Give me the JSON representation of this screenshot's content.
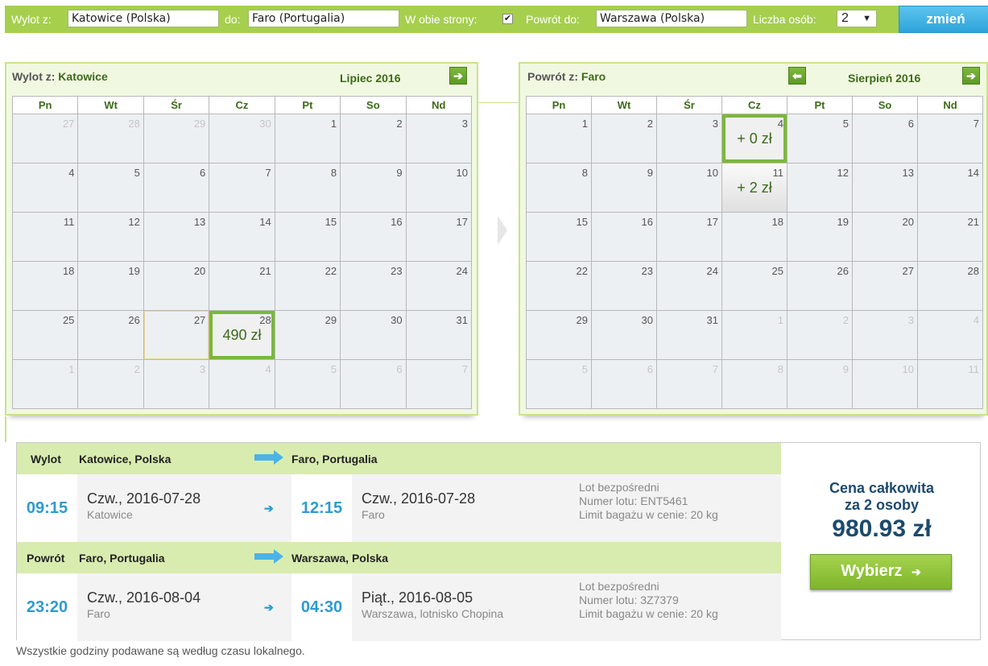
{
  "search": {
    "from_label": "Wylot z:",
    "from_value": "Katowice (Polska)",
    "to_label": "do:",
    "to_value": "Faro (Portugalia)",
    "roundtrip_label": "W obie strony:",
    "roundtrip_checked": "✔",
    "return_label": "Powrót do:",
    "return_value": "Warszawa (Polska)",
    "persons_label": "Liczba osób:",
    "persons_value": "2",
    "change_button": "zmień"
  },
  "outbound_calendar": {
    "header_prefix": "Wylot z:",
    "header_city": "Katowice",
    "month": "Lipiec 2016",
    "next_icon": "arrow-right-icon",
    "weekdays": [
      "Pn",
      "Wt",
      "Śr",
      "Cz",
      "Pt",
      "So",
      "Nd"
    ],
    "days": [
      {
        "n": "27",
        "other": true
      },
      {
        "n": "28",
        "other": true
      },
      {
        "n": "29",
        "other": true
      },
      {
        "n": "30",
        "other": true
      },
      {
        "n": "1"
      },
      {
        "n": "2"
      },
      {
        "n": "3"
      },
      {
        "n": "4"
      },
      {
        "n": "5"
      },
      {
        "n": "6"
      },
      {
        "n": "7"
      },
      {
        "n": "8"
      },
      {
        "n": "9"
      },
      {
        "n": "10"
      },
      {
        "n": "11"
      },
      {
        "n": "12"
      },
      {
        "n": "13"
      },
      {
        "n": "14"
      },
      {
        "n": "15"
      },
      {
        "n": "16"
      },
      {
        "n": "17"
      },
      {
        "n": "18"
      },
      {
        "n": "19"
      },
      {
        "n": "20"
      },
      {
        "n": "21"
      },
      {
        "n": "22"
      },
      {
        "n": "23"
      },
      {
        "n": "24"
      },
      {
        "n": "25"
      },
      {
        "n": "26"
      },
      {
        "n": "27",
        "dashed": true
      },
      {
        "n": "28",
        "price": "490 zł",
        "selected": true
      },
      {
        "n": "29"
      },
      {
        "n": "30"
      },
      {
        "n": "31"
      },
      {
        "n": "1",
        "other": true
      },
      {
        "n": "2",
        "other": true
      },
      {
        "n": "3",
        "other": true
      },
      {
        "n": "4",
        "other": true
      },
      {
        "n": "5",
        "other": true
      },
      {
        "n": "6",
        "other": true
      },
      {
        "n": "7",
        "other": true
      }
    ]
  },
  "return_calendar": {
    "header_prefix": "Powrót z:",
    "header_city": "Faro",
    "month": "Sierpień 2016",
    "prev_icon": "arrow-left-icon",
    "next_icon": "arrow-right-icon",
    "weekdays": [
      "Pn",
      "Wt",
      "Śr",
      "Cz",
      "Pt",
      "So",
      "Nd"
    ],
    "days": [
      {
        "n": "1"
      },
      {
        "n": "2"
      },
      {
        "n": "3"
      },
      {
        "n": "4",
        "price": "+ 0 zł",
        "selected": true
      },
      {
        "n": "5"
      },
      {
        "n": "6"
      },
      {
        "n": "7"
      },
      {
        "n": "8"
      },
      {
        "n": "9"
      },
      {
        "n": "10"
      },
      {
        "n": "11",
        "price": "+ 2 zł",
        "highlight": true
      },
      {
        "n": "12"
      },
      {
        "n": "13"
      },
      {
        "n": "14"
      },
      {
        "n": "15"
      },
      {
        "n": "16"
      },
      {
        "n": "17"
      },
      {
        "n": "18"
      },
      {
        "n": "19"
      },
      {
        "n": "20"
      },
      {
        "n": "21"
      },
      {
        "n": "22"
      },
      {
        "n": "23"
      },
      {
        "n": "24"
      },
      {
        "n": "25"
      },
      {
        "n": "26"
      },
      {
        "n": "27"
      },
      {
        "n": "28"
      },
      {
        "n": "29"
      },
      {
        "n": "30"
      },
      {
        "n": "31"
      },
      {
        "n": "1",
        "other": true
      },
      {
        "n": "2",
        "other": true
      },
      {
        "n": "3",
        "other": true
      },
      {
        "n": "4",
        "other": true
      },
      {
        "n": "5",
        "other": true
      },
      {
        "n": "6",
        "other": true
      },
      {
        "n": "7",
        "other": true
      },
      {
        "n": "8",
        "other": true
      },
      {
        "n": "9",
        "other": true
      },
      {
        "n": "10",
        "other": true
      },
      {
        "n": "11",
        "other": true
      }
    ]
  },
  "outbound": {
    "label": "Wylot",
    "from": "Katowice, Polska",
    "to": "Faro, Portugalia",
    "dep_time": "09:15",
    "dep_date": "Czw., 2016-07-28",
    "dep_city": "Katowice",
    "arr_time": "12:15",
    "arr_date": "Czw., 2016-07-28",
    "arr_city": "Faro",
    "info_type": "Lot bezpośredni",
    "info_flight": "Numer lotu: ENT5461",
    "info_baggage": "Limit bagażu w cenie: 20 kg"
  },
  "return": {
    "label": "Powrót",
    "from": "Faro, Portugalia",
    "to": "Warszawa, Polska",
    "dep_time": "23:20",
    "dep_date": "Czw., 2016-08-04",
    "dep_city": "Faro",
    "arr_time": "04:30",
    "arr_date": "Piąt., 2016-08-05",
    "arr_city": "Warszawa, lotnisko Chopina",
    "info_type": "Lot bezpośredni",
    "info_flight": "Numer lotu: 3Z7379",
    "info_baggage": "Limit bagażu w cenie: 20 kg"
  },
  "price": {
    "label_line1": "Cena całkowita",
    "label_line2": "za 2 osoby",
    "value": "980.93 zł",
    "select_button": "Wybierz",
    "select_icon": "arrow-right-icon"
  },
  "footnote": "Wszystkie godziny podawane są według czasu lokalnego.",
  "colors": {
    "accent_green": "#a6cf4e",
    "dark_green": "#3d6a1a",
    "blue": "#2d9bd0",
    "navy": "#1d4a6d"
  }
}
